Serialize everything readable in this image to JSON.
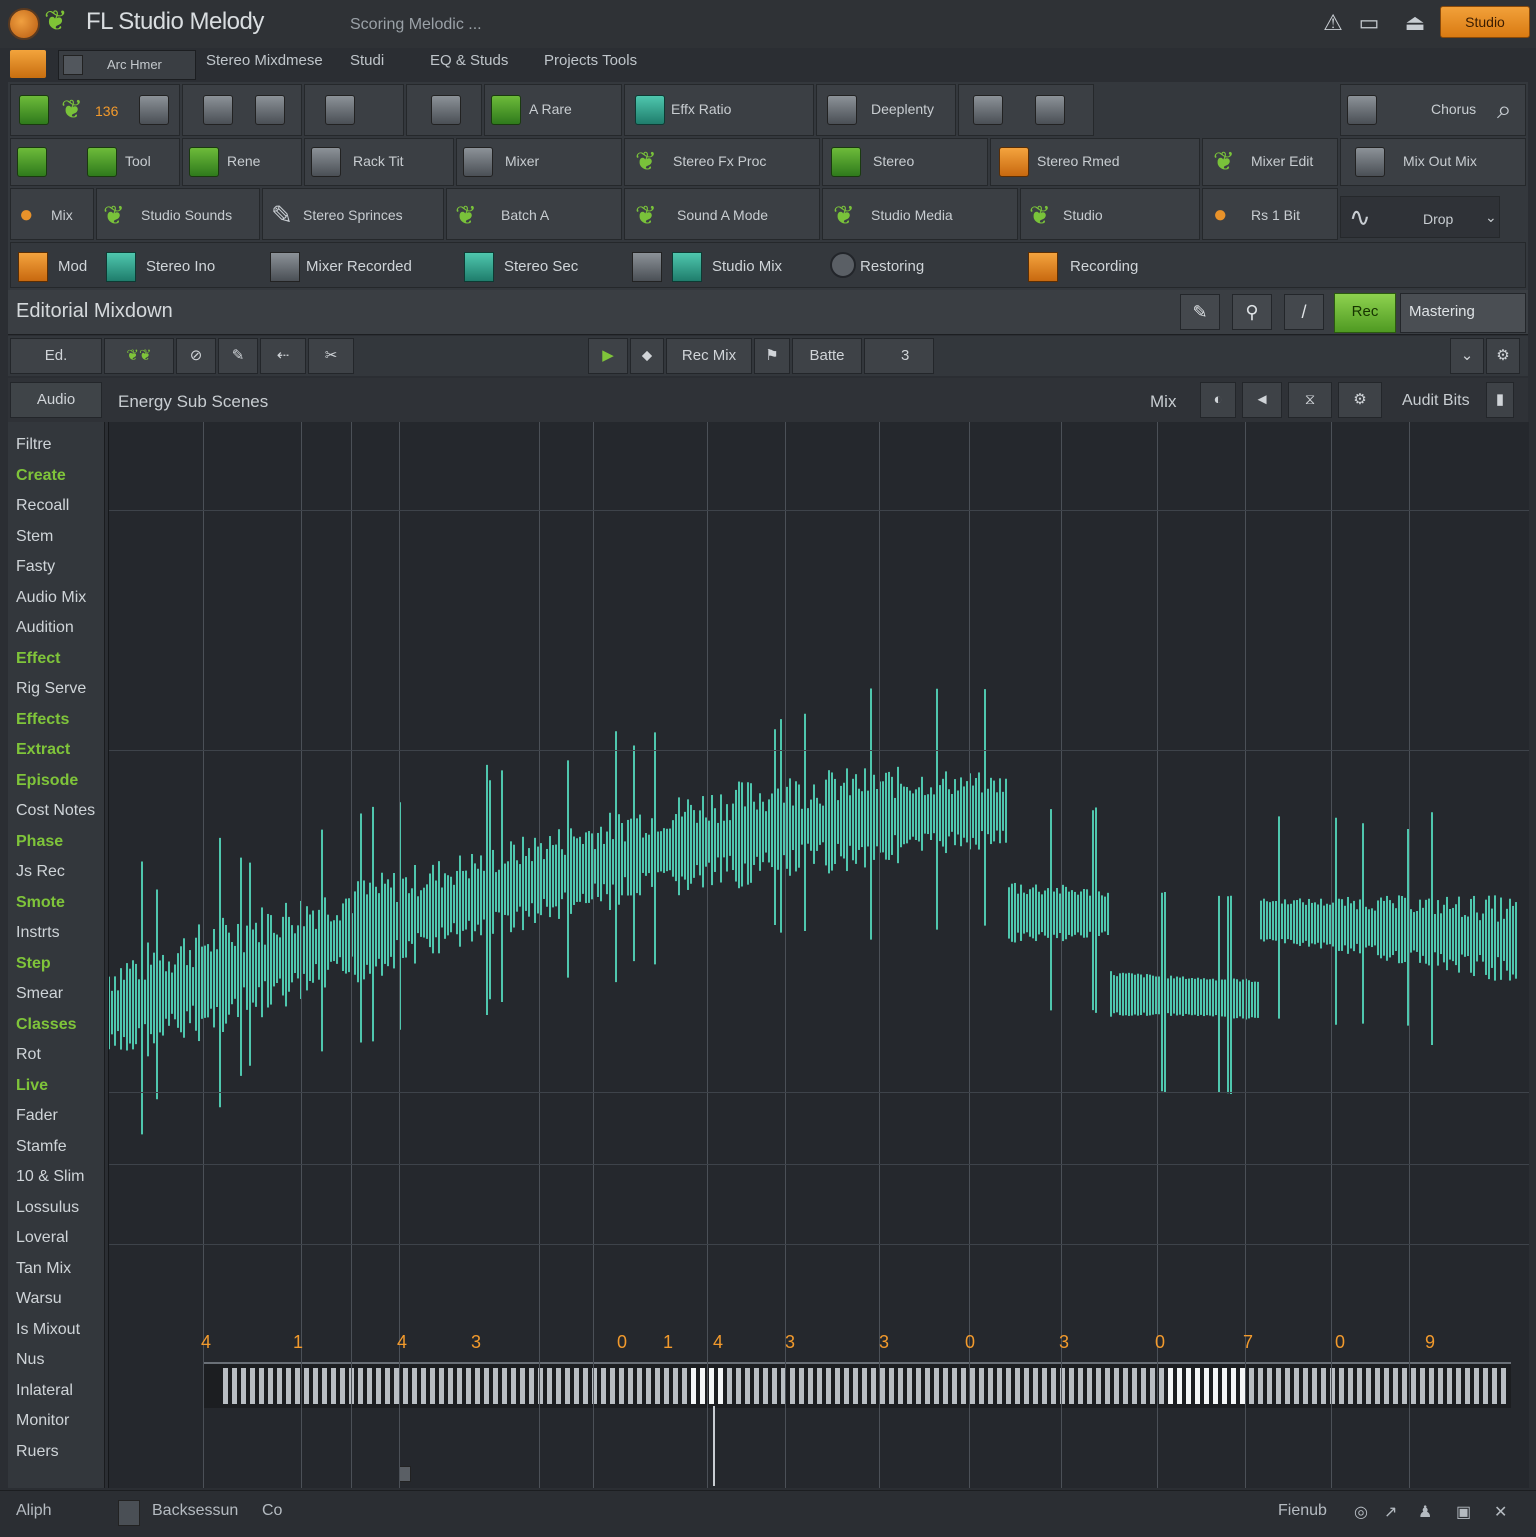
{
  "window": {
    "title": "FL Studio Melody",
    "subtitle": "Scoring Melodic ...",
    "badge": "Studio"
  },
  "menu": {
    "selector_label": "Arc Hmer",
    "items": [
      "Stereo Mixdmese",
      "Studi",
      "EQ & Studs",
      "Projects Tools"
    ]
  },
  "tools": {
    "row1": [
      "136",
      "A Rare",
      "Effx Ratio",
      "Deeplenty",
      "Chorus"
    ],
    "row2": [
      "Tool",
      "Rene",
      "Rack Tit",
      "Mixer",
      "Stereo Fx Proc",
      "Stereo",
      "Stereo Rmed",
      "Mixer Edit",
      "Mix Out Mix"
    ],
    "row3": [
      "Mix",
      "Studio Sounds",
      "Stereo Sprinces",
      "Batch A",
      "Sound A Mode",
      "Studio Media",
      "Studio",
      "Rs 1 Bit",
      "Drop"
    ],
    "row4": [
      "Mod",
      "Stereo Ino",
      "Mixer Recorded",
      "Stereo Sec",
      "Studio Mix",
      "Restoring",
      "Recording"
    ]
  },
  "panel": {
    "title": "Editorial Mixdown",
    "right_button": "Rec",
    "mode_label": "Mastering",
    "row2_labels": [
      "Ed.",
      "Rec Mix",
      "Batte",
      "3"
    ],
    "row3_left": "Audio",
    "row3_title": "Energy Sub Scenes",
    "row3_right": "Mix",
    "row3_end": "Audit Bits"
  },
  "sidebar": [
    {
      "label": "Filtre",
      "style": "light"
    },
    {
      "label": "Create",
      "style": "green"
    },
    {
      "label": "Recoall",
      "style": "light"
    },
    {
      "label": "Stem",
      "style": "light"
    },
    {
      "label": "Fasty",
      "style": "light"
    },
    {
      "label": "Audio Mix",
      "style": "light"
    },
    {
      "label": "Audition",
      "style": "light"
    },
    {
      "label": "Effect",
      "style": "green"
    },
    {
      "label": "Rig Serve",
      "style": "light"
    },
    {
      "label": "Effects",
      "style": "green"
    },
    {
      "label": "Extract",
      "style": "green"
    },
    {
      "label": "Episode",
      "style": "green"
    },
    {
      "label": "Cost Notes",
      "style": "light"
    },
    {
      "label": "Phase",
      "style": "green"
    },
    {
      "label": "Js Rec",
      "style": "light"
    },
    {
      "label": "Smote",
      "style": "green"
    },
    {
      "label": "Instrts",
      "style": "light"
    },
    {
      "label": "Step",
      "style": "green"
    },
    {
      "label": "Smear",
      "style": "light"
    },
    {
      "label": "Classes",
      "style": "green"
    },
    {
      "label": "Rot",
      "style": "light"
    },
    {
      "label": "Live",
      "style": "green"
    },
    {
      "label": "Fader",
      "style": "light"
    },
    {
      "label": "Stamfe",
      "style": "light"
    },
    {
      "label": "10 & Slim",
      "style": "light"
    },
    {
      "label": "Lossulus",
      "style": "light"
    },
    {
      "label": "Loveral",
      "style": "light"
    },
    {
      "label": "Tan Mix",
      "style": "light"
    },
    {
      "label": "Warsu",
      "style": "light"
    },
    {
      "label": "Is Mixout",
      "style": "light"
    },
    {
      "label": "Nus",
      "style": "light"
    },
    {
      "label": "Inlateral",
      "style": "light"
    },
    {
      "label": "Monitor",
      "style": "light"
    },
    {
      "label": "Ruers",
      "style": "light"
    }
  ],
  "timeline": {
    "numbers": [
      "4",
      "1",
      "4",
      "3",
      "0",
      "1",
      "4",
      "3",
      "3",
      "0",
      "3",
      "0",
      "7",
      "0",
      "9"
    ]
  },
  "status": {
    "left": "Aliph",
    "center": "Backsessun",
    "center2": "Co",
    "right": "Fienub"
  },
  "colors": {
    "accent_green": "#7fc43a",
    "accent_orange": "#f29a2c",
    "waveform": "#4fc7ae",
    "background": "#2b2e33"
  }
}
